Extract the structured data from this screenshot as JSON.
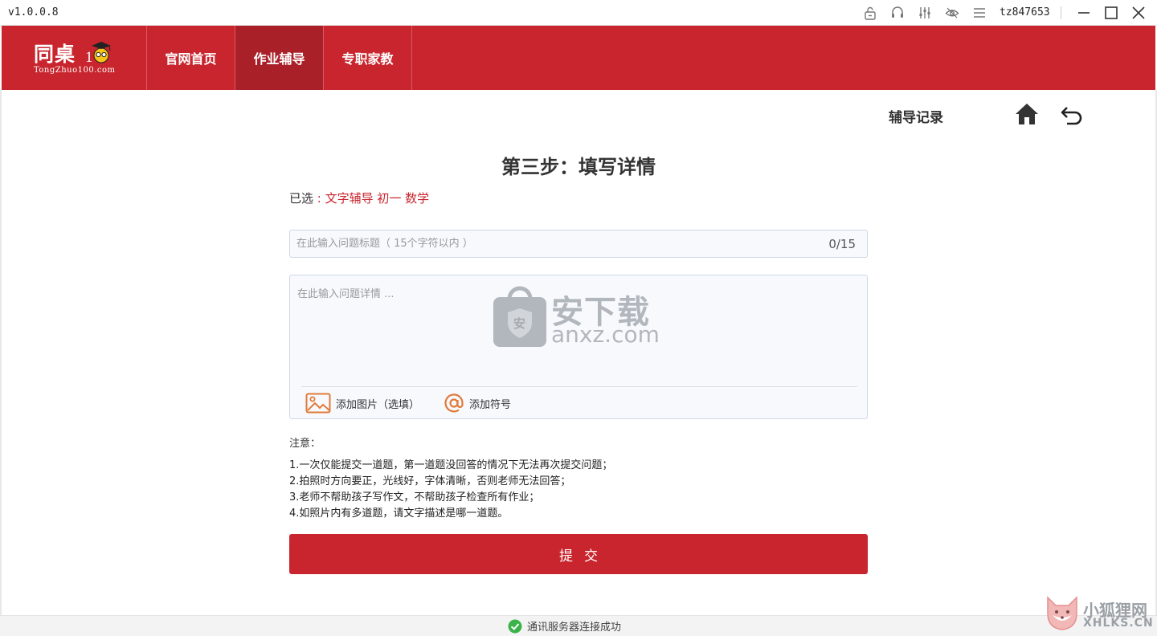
{
  "titlebar": {
    "version": "v1.0.0.8",
    "username": "tz847653",
    "icons": [
      "lock-icon",
      "headset-icon",
      "sliders-icon",
      "eye-icon",
      "menu-icon",
      "minimize-icon",
      "maximize-icon",
      "close-icon"
    ]
  },
  "header": {
    "logo_cn": "同桌",
    "logo_en": "TongZhuo100.com",
    "nav": [
      {
        "label": "官网首页",
        "active": false
      },
      {
        "label": "作业辅导",
        "active": true
      },
      {
        "label": "专职家教",
        "active": false
      }
    ],
    "brand_color": "#c8252e"
  },
  "main": {
    "records_link": "辅导记录",
    "step_title": "第三步：填写详情",
    "selected_prefix": "已选",
    "selected_value": " : 文字辅导 初一 数学",
    "title_placeholder": "在此输入问题标题（ 15个字符以内 ）",
    "title_counter": "0/15",
    "detail_placeholder": "在此输入问题详情 ...",
    "add_image_label": "添加图片（选填）",
    "add_symbol_label": "添加符号",
    "notes_heading": "注意：",
    "notes": [
      "1.一次仅能提交一道题，第一道题没回答的情况下无法再次提交问题；",
      "2.拍照时方向要正，光线好，字体清晰，否则老师无法回答；",
      "3.老师不帮助孩子写作文，不帮助孩子检查所有作业；",
      "4.如照片内有多道题，请文字描述是哪一道题。"
    ],
    "submit_label": "提交"
  },
  "status": {
    "text": "通讯服务器连接成功",
    "color": "#3cb34a"
  },
  "watermarks": {
    "center_cn": "安下载",
    "center_url": "anxz.com",
    "corner_cn": "小狐狸网",
    "corner_url": "XHLKS.CN"
  }
}
